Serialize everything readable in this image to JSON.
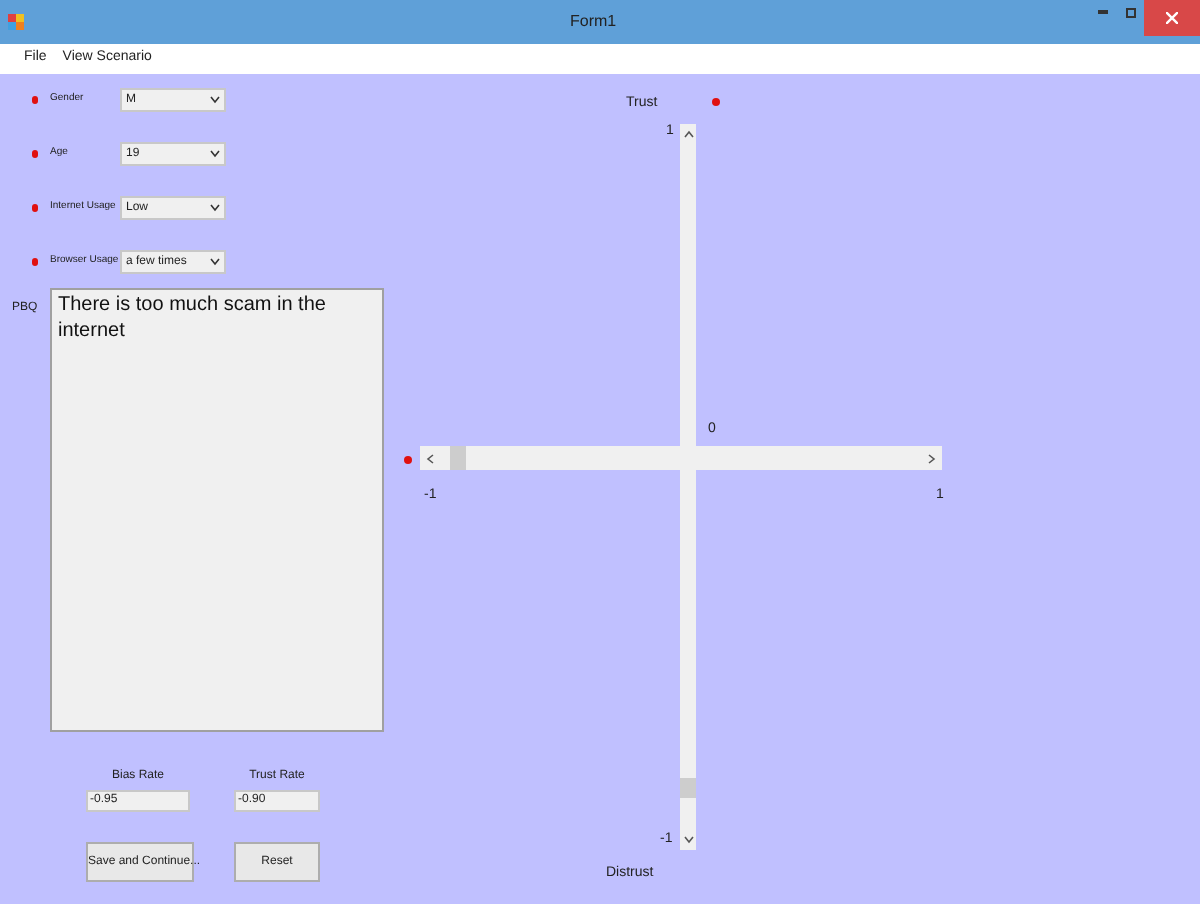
{
  "window": {
    "title": "Form1"
  },
  "menu": [
    "File",
    "View Scenario"
  ],
  "fields": [
    {
      "label": "Gender",
      "value": "M",
      "required": true
    },
    {
      "label": "Age",
      "value": "19",
      "required": true
    },
    {
      "label": "Internet Usage",
      "value": "Low",
      "required": true
    },
    {
      "label": "Browser Usage",
      "value": "a few times",
      "required": true
    }
  ],
  "pbq": {
    "label": "PBQ",
    "text": "There is too much scam in the internet"
  },
  "rates": [
    {
      "label": "Bias Rate",
      "value": "-0.95"
    },
    {
      "label": "Trust Rate",
      "value": "-0.90"
    }
  ],
  "buttons": [
    "Save and Continue...",
    "Reset"
  ],
  "trust_axis": {
    "top_label": "Trust",
    "bottom_label": "Distrust",
    "max": "1",
    "min": "-1",
    "required": true
  },
  "bias_axis": {
    "center": "0",
    "min": "-1",
    "max": "1",
    "required": true
  }
}
